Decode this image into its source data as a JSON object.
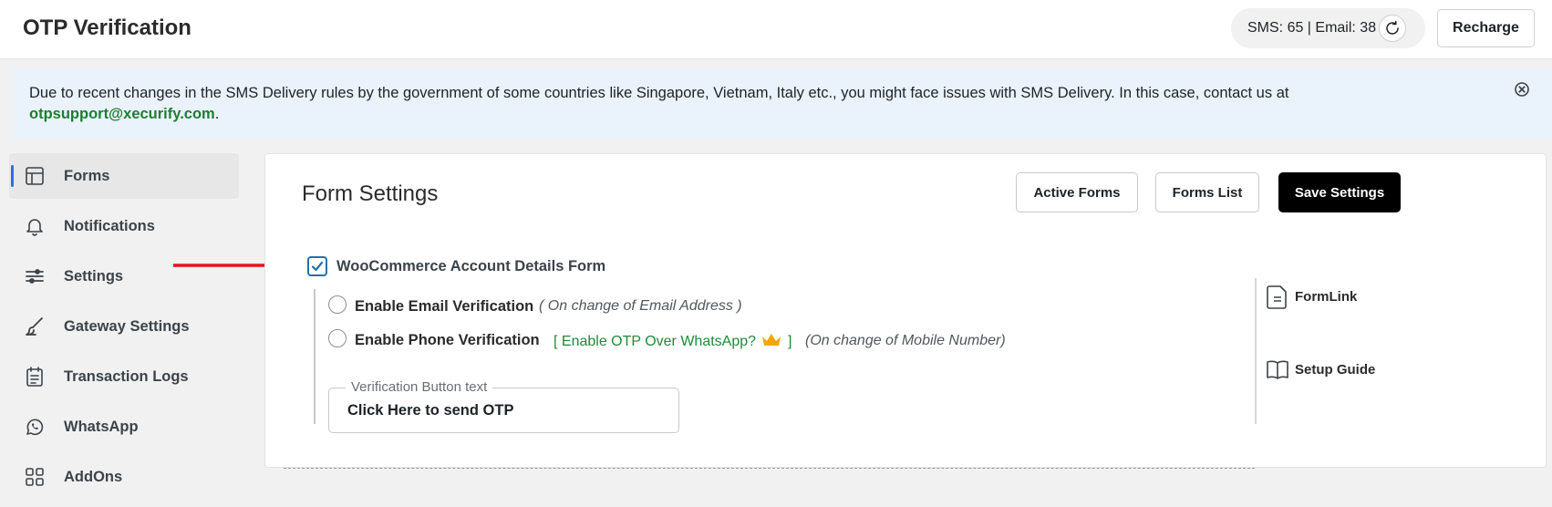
{
  "header": {
    "title": "OTP Verification",
    "balance": "SMS: 65 | Email: 38",
    "recharge_label": "Recharge"
  },
  "notice": {
    "text": "Due to recent changes in the SMS Delivery rules by the government of some countries like Singapore, Vietnam, Italy etc., you might face issues with SMS Delivery. In this case, contact us at ",
    "email": "otpsupport@xecurify.com",
    "trailing": "."
  },
  "sidebar": {
    "items": [
      {
        "label": "Forms",
        "icon": "layout-icon",
        "active": true
      },
      {
        "label": "Notifications",
        "icon": "bell-icon",
        "active": false
      },
      {
        "label": "Settings",
        "icon": "sliders-icon",
        "active": false
      },
      {
        "label": "Gateway Settings",
        "icon": "brush-icon",
        "active": false
      },
      {
        "label": "Transaction Logs",
        "icon": "log-icon",
        "active": false
      },
      {
        "label": "WhatsApp",
        "icon": "whatsapp-icon",
        "active": false
      },
      {
        "label": "AddOns",
        "icon": "grid-icon",
        "active": false
      }
    ]
  },
  "panel": {
    "title": "Form Settings",
    "active_forms_label": "Active Forms",
    "forms_list_label": "Forms List",
    "save_label": "Save Settings",
    "form": {
      "name": "WooCommerce Account Details Form",
      "checked": true,
      "email_option": "Enable Email Verification",
      "email_note": "( On change of Email Address )",
      "phone_option": "Enable Phone Verification",
      "whatsapp_link_open": "[ Enable OTP Over WhatsApp?",
      "whatsapp_link_close": "]",
      "phone_note": "(On change of Mobile Number)",
      "button_text_label": "Verification Button text",
      "button_text_value": "Click Here to send OTP"
    },
    "links": {
      "formlink": "FormLink",
      "setup_guide": "Setup Guide"
    }
  },
  "colors": {
    "accent_blue": "#2271b1",
    "whatsapp_green": "#1e8a3a",
    "annotation_red": "#e3141b",
    "crown_gold": "#f0a800"
  }
}
